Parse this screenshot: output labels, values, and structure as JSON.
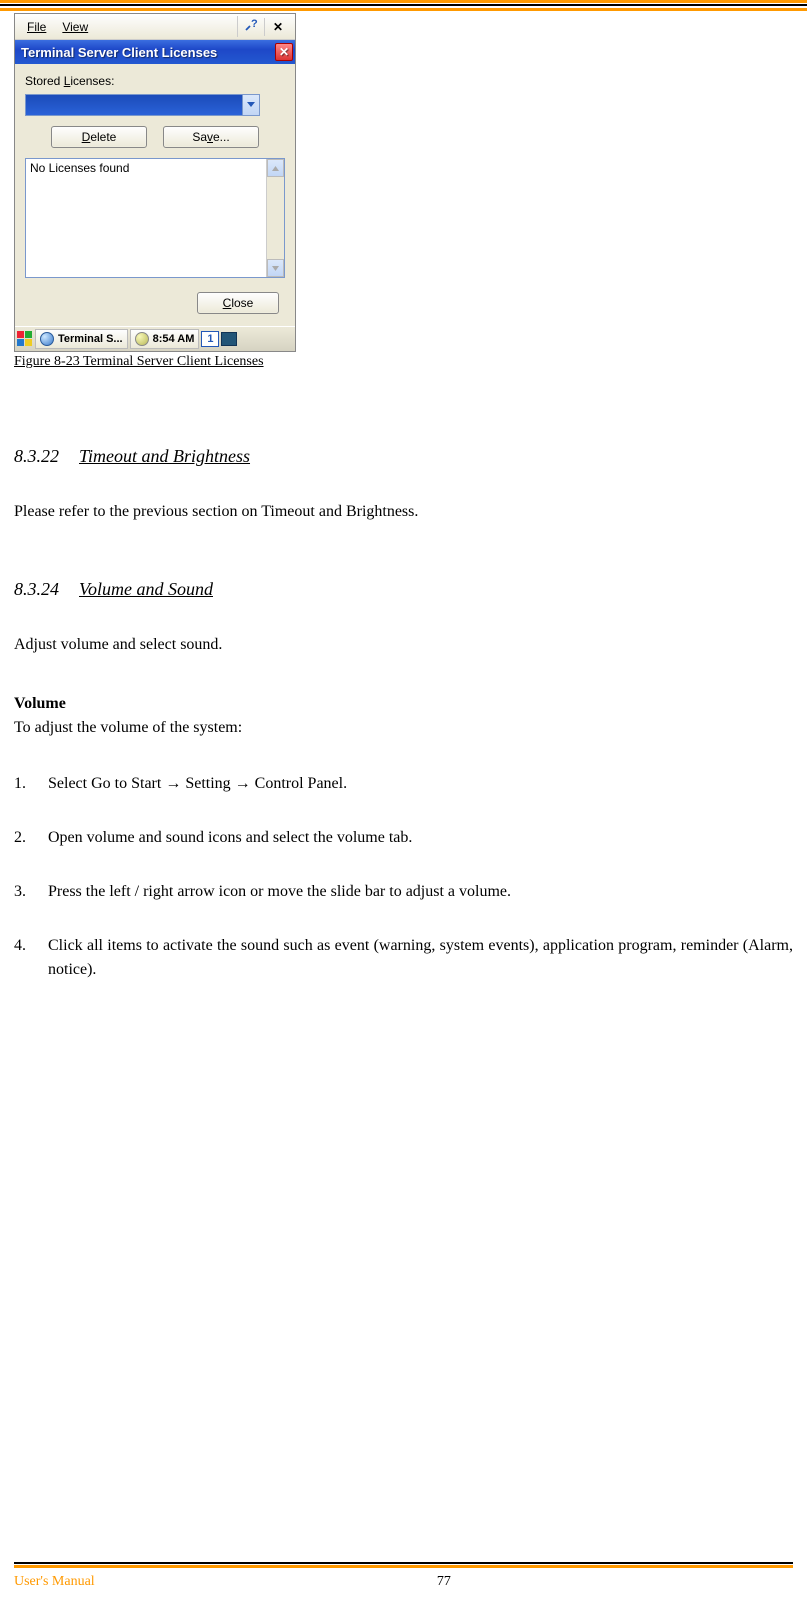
{
  "top_border": true,
  "screenshot": {
    "menubar": {
      "file": "File",
      "view": "View",
      "help": "?",
      "close": "✕"
    },
    "titlebar": {
      "title": "Terminal Server Client Licenses",
      "close": "✕"
    },
    "stored_label_pre": "Stored ",
    "stored_label_u": "L",
    "stored_label_post": "icenses:",
    "combo_value": "",
    "buttons": {
      "delete_u": "D",
      "delete_post": "elete",
      "save_pre": "Sa",
      "save_u": "v",
      "save_post": "e..."
    },
    "list_text": "No Licenses found",
    "close_btn_u": "C",
    "close_btn_post": "lose",
    "taskbar": {
      "app": "Terminal S...",
      "time": "8:54 AM",
      "kb": "1"
    }
  },
  "figure_caption": "Figure 8-23 Terminal Server Client Licenses",
  "section1": {
    "num": "8.3.22",
    "title": "Timeout and Brightness",
    "body": "Please refer to the previous section on Timeout and Brightness."
  },
  "section2": {
    "num": "8.3.24",
    "title": "Volume and Sound",
    "intro": "Adjust volume and select sound.",
    "bold": "Volume",
    "desc": "To adjust the volume of the system:",
    "steps": [
      "Select Go to Start → Setting → Control Panel.",
      "Open volume and sound icons and select the volume tab.",
      "Press the left / right arrow icon or move the slide bar to adjust a volume.",
      "Click all items to activate the sound such as event (warning, system events), application program, reminder (Alarm, notice)."
    ]
  },
  "footer": {
    "left": "User's Manual",
    "page": "77"
  }
}
